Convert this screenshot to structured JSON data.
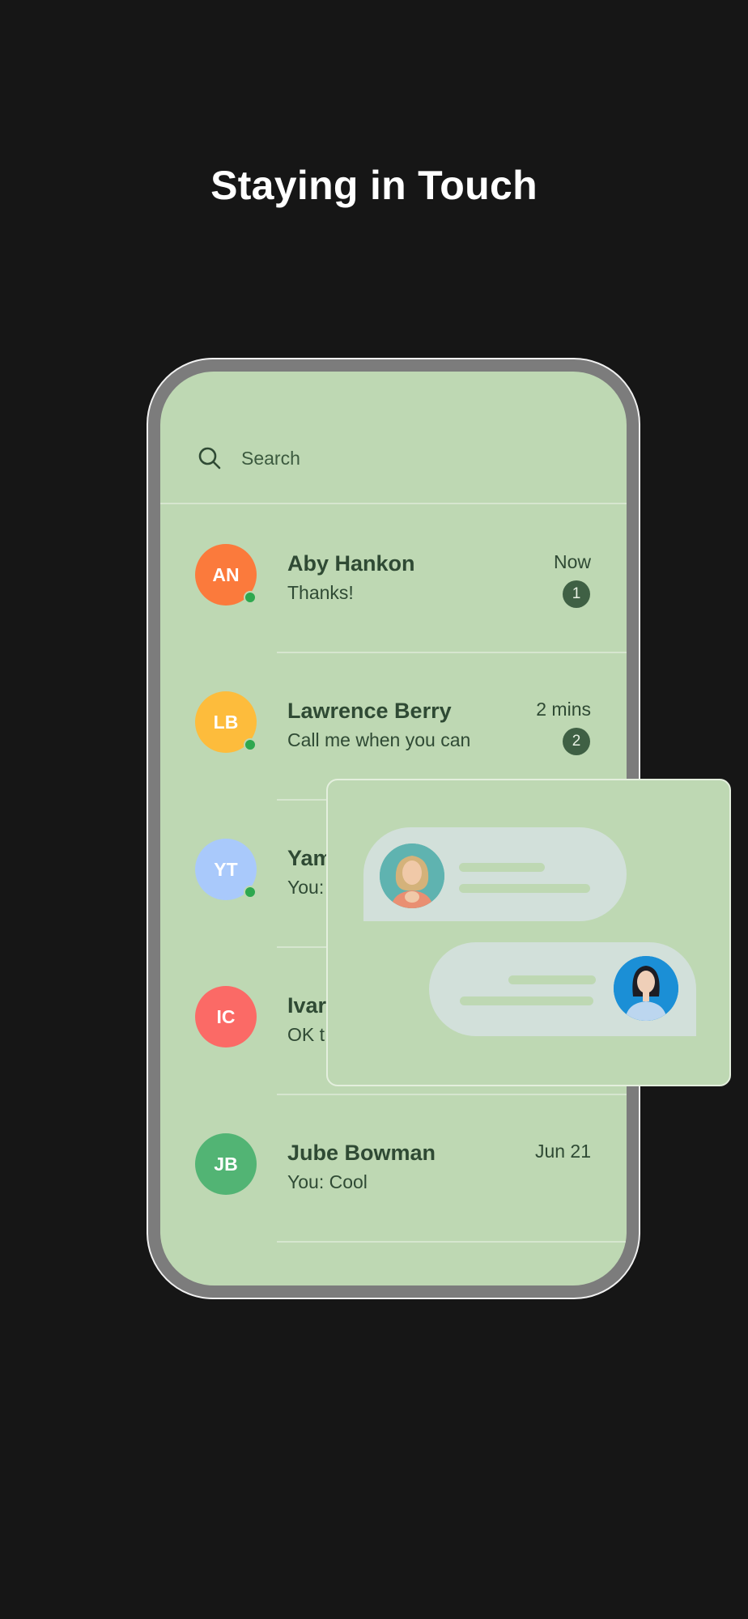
{
  "headline": "Staying in Touch",
  "search": {
    "placeholder": "Search",
    "icon": "search-icon"
  },
  "chats": [
    {
      "initials": "AN",
      "name": "Aby Hankon",
      "message": "Thanks!",
      "time": "Now",
      "unread": "1",
      "online": true,
      "color": "#fb7a3c"
    },
    {
      "initials": "LB",
      "name": "Lawrence Berry",
      "message": "Call me when you can",
      "time": "2 mins",
      "unread": "2",
      "online": true,
      "color": "#fdbc3c"
    },
    {
      "initials": "YT",
      "name": "Yam",
      "message": "You:",
      "time": "",
      "unread": "",
      "online": true,
      "color": "#a9c9fb"
    },
    {
      "initials": "IC",
      "name": "Ivar",
      "message": "OK t",
      "time": "",
      "unread": "",
      "online": false,
      "color": "#fb6a66"
    },
    {
      "initials": "JB",
      "name": "Jube Bowman",
      "message": "You: Cool",
      "time": "Jun 21",
      "unread": "",
      "online": false,
      "color": "#52b474"
    }
  ],
  "colors": {
    "background": "#161616",
    "screen": "#bed8b3",
    "text": "#2f4a34",
    "badge": "#3f6044",
    "online": "#2ea84f"
  }
}
